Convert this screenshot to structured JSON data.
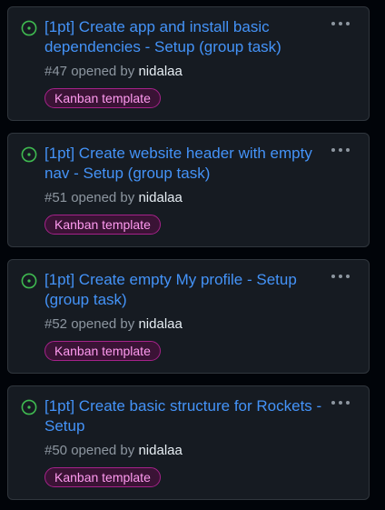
{
  "colors": {
    "background": "#010409",
    "card_bg": "#161b22",
    "card_border": "#30363d",
    "title": "#4493f8",
    "open_icon": "#3fb950",
    "muted_text": "#8d96a0",
    "author_text": "#e6edf3",
    "label_bg": "#3a1335",
    "label_border": "#a6228a",
    "label_text": "#ff9bf0"
  },
  "icons": {
    "status": "issue-opened-icon",
    "menu": "kebab-horizontal-icon"
  },
  "cards": [
    {
      "title": "[1pt] Create app and install basic dependencies - Setup (group task)",
      "number": "#47",
      "opened_by": "opened by",
      "author": "nidalaa",
      "label": "Kanban template"
    },
    {
      "title": "[1pt] Create website header with empty nav - Setup (group task)",
      "number": "#51",
      "opened_by": "opened by",
      "author": "nidalaa",
      "label": "Kanban template"
    },
    {
      "title": "[1pt] Create empty My profile - Setup (group task)",
      "number": "#52",
      "opened_by": "opened by",
      "author": "nidalaa",
      "label": "Kanban template"
    },
    {
      "title": "[1pt] Create basic structure for Rockets - Setup",
      "number": "#50",
      "opened_by": "opened by",
      "author": "nidalaa",
      "label": "Kanban template"
    }
  ]
}
